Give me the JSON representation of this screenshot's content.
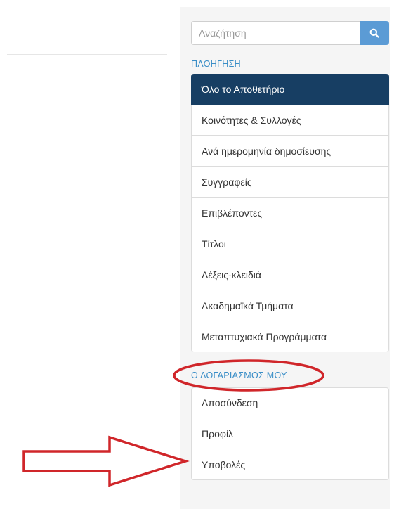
{
  "search": {
    "placeholder": "Αναζήτηση",
    "button_icon": "search-icon"
  },
  "navigation": {
    "header": "ΠΛΟΗΓΗΣΗ",
    "items": [
      {
        "label": "Όλο το Αποθετήριο",
        "active": true
      },
      {
        "label": "Κοινότητες & Συλλογές"
      },
      {
        "label": "Ανά ημερομηνία δημοσίευσης"
      },
      {
        "label": "Συγγραφείς"
      },
      {
        "label": "Επιβλέποντες"
      },
      {
        "label": "Τίτλοι"
      },
      {
        "label": "Λέξεις-κλειδιά"
      },
      {
        "label": "Ακαδημαϊκά Τμήματα"
      },
      {
        "label": "Μεταπτυχιακά Προγράμματα"
      }
    ]
  },
  "account": {
    "header": "Ο ΛΟΓΑΡΙΑΣΜΟΣ ΜΟΥ",
    "items": [
      {
        "label": "Αποσύνδεση"
      },
      {
        "label": "Προφίλ"
      },
      {
        "label": "Υποβολές"
      }
    ]
  },
  "colors": {
    "active_background": "#173e63",
    "section_header": "#3a8ec7",
    "search_button": "#5b9bd5",
    "annotation": "#d0262a"
  }
}
